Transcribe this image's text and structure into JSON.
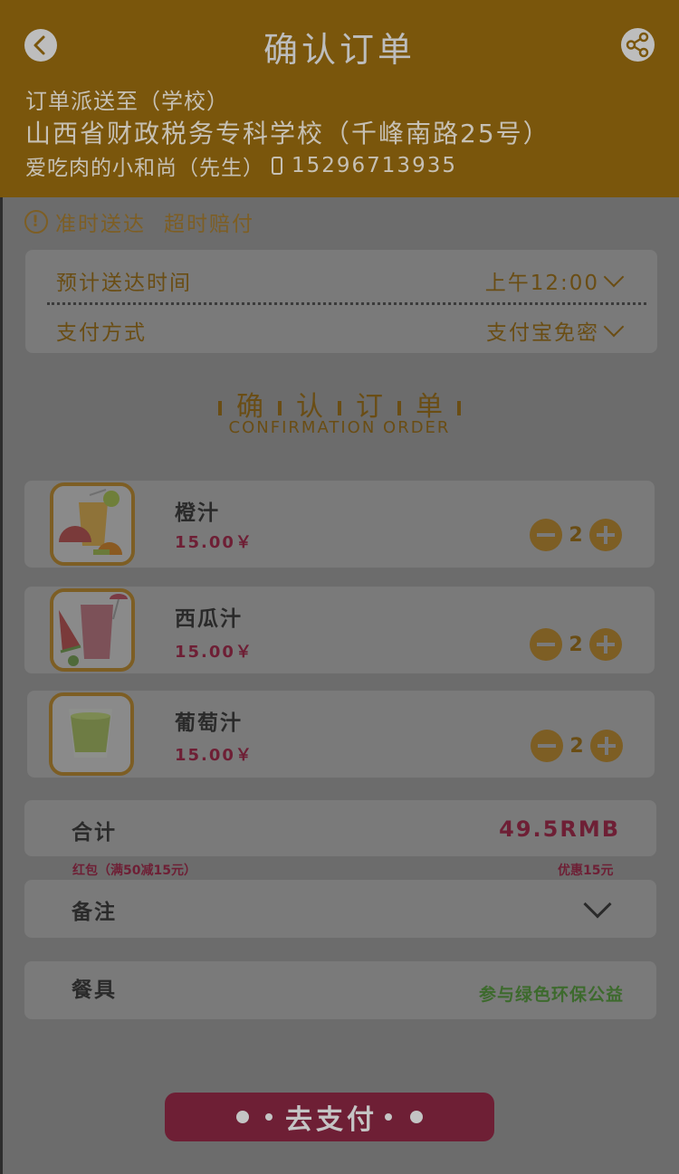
{
  "header": {
    "title": "确认订单",
    "address_label": "订单派送至（学校）",
    "address": "山西省财政税务专科学校（千峰南路25号）",
    "contact_name": "爱吃肉的小和尚（先生）",
    "phone": "15296713935"
  },
  "notice": {
    "on_time": "准时送达",
    "compensation": "超时赔付"
  },
  "delivery": {
    "time_label": "预计送达时间",
    "time_value": "上午12:00",
    "payment_label": "支付方式",
    "payment_value": "支付宝免密"
  },
  "section": {
    "chars": [
      "确",
      "认",
      "订",
      "单"
    ],
    "subtitle": "CONFIRMATION  ORDER"
  },
  "items": [
    {
      "name": "橙汁",
      "price": "15.00￥",
      "qty": "2"
    },
    {
      "name": "西瓜汁",
      "price": "15.00￥",
      "qty": "2"
    },
    {
      "name": "葡萄汁",
      "price": "15.00￥",
      "qty": "2"
    }
  ],
  "summary": {
    "total_label": "合计",
    "total_value": "49.5RMB",
    "coupon": "红包（满50减15元）",
    "discount": "优惠15元"
  },
  "note": {
    "label": "备注"
  },
  "tableware": {
    "label": "餐具",
    "value": "参与绿色环保公益"
  },
  "pay_button": {
    "label": "去支付"
  },
  "colors": {
    "header_bg": "#7a560c",
    "accent": "#7d5e24",
    "price": "#6e1f35",
    "green": "#3d6a2d",
    "card_bg": "#7a7a7a",
    "page_bg": "#6c6c6c"
  },
  "icons": {
    "back": "chevron-left-icon",
    "share": "share-icon",
    "phone": "phone-icon",
    "notice": "exclamation-circle-icon",
    "dropdown": "chevron-down-icon",
    "minus": "minus-circle-icon",
    "plus": "plus-circle-icon"
  }
}
